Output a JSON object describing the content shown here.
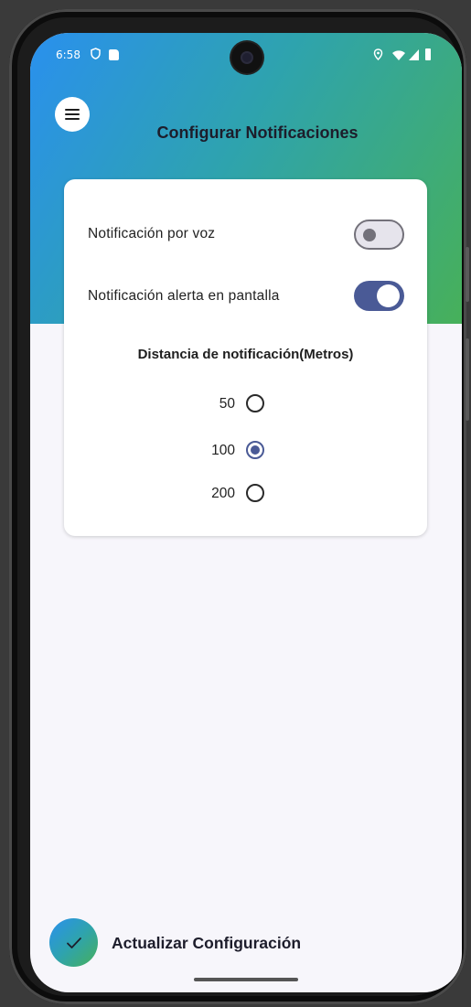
{
  "status_bar": {
    "time": "6:58",
    "left_icons": [
      "shield-icon",
      "sd-card-icon"
    ],
    "right_icons": [
      "location-icon",
      "wifi-icon",
      "signal-icon",
      "battery-icon"
    ]
  },
  "header": {
    "menu_icon": "menu-icon",
    "title": "Configurar Notificaciones",
    "gradient_colors": [
      "#2a90ee",
      "#2ea3ae",
      "#47b05a"
    ]
  },
  "settings": {
    "voice_notification": {
      "label": "Notificación por voz",
      "enabled": false
    },
    "screen_alert": {
      "label": "Notificación alerta en pantalla",
      "enabled": true
    },
    "distance": {
      "title": "Distancia de notificación(Metros)",
      "options": [
        {
          "label": "50",
          "selected": false
        },
        {
          "label": "100",
          "selected": true
        },
        {
          "label": "200",
          "selected": false
        }
      ]
    }
  },
  "action": {
    "icon": "check-icon",
    "label": "Actualizar Configuración"
  },
  "colors": {
    "accent": "#4a5a96",
    "background": "#f7f6fb"
  }
}
